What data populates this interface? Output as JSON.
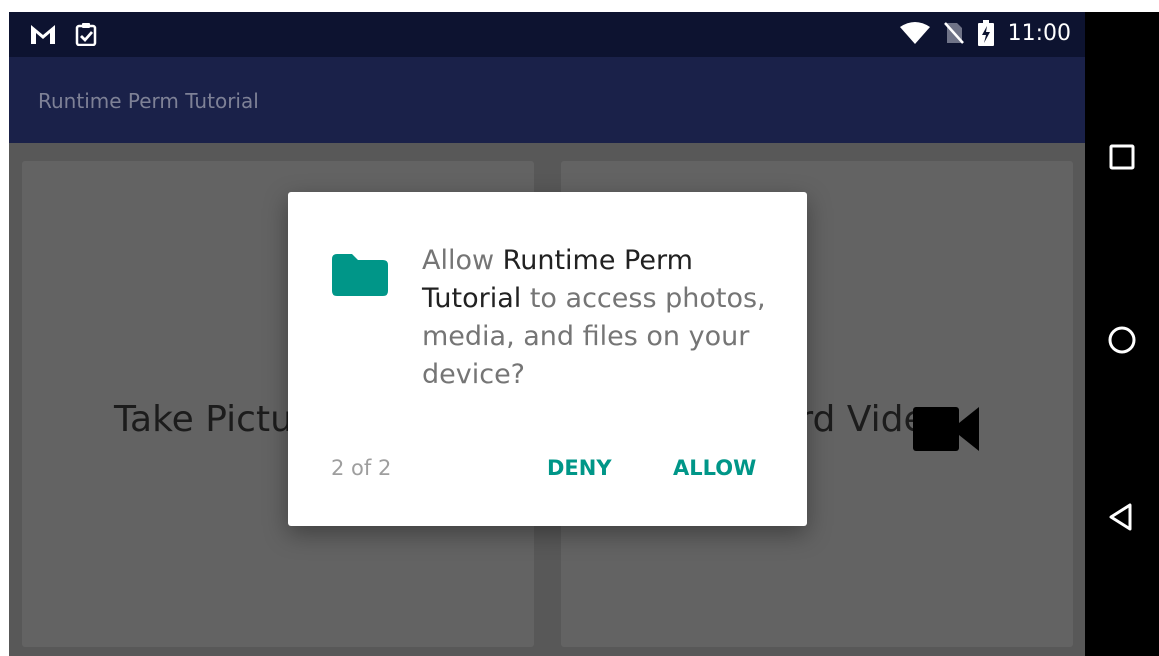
{
  "status_bar": {
    "left_icons": [
      "gmail-icon",
      "clipboard-check-icon"
    ],
    "right_icons": [
      "wifi-icon",
      "no-sim-icon",
      "battery-charging-icon"
    ],
    "time": "11:00"
  },
  "app_bar": {
    "title": "Runtime Perm Tutorial",
    "background": "#1a2149"
  },
  "cards": [
    {
      "label": "Take Picture"
    },
    {
      "label": "Record Video",
      "icon": "videocam-icon"
    }
  ],
  "dialog": {
    "icon": "folder-icon",
    "message_prefix": "Allow ",
    "app_name": "Runtime Perm Tutorial",
    "message_suffix": " to access photos, media, and files on your device?",
    "counter": "2 of 2",
    "deny_label": "DENY",
    "allow_label": "ALLOW",
    "accent_color": "#009688"
  },
  "nav_bar": {
    "buttons": [
      "recents-icon",
      "home-icon",
      "back-icon"
    ]
  }
}
